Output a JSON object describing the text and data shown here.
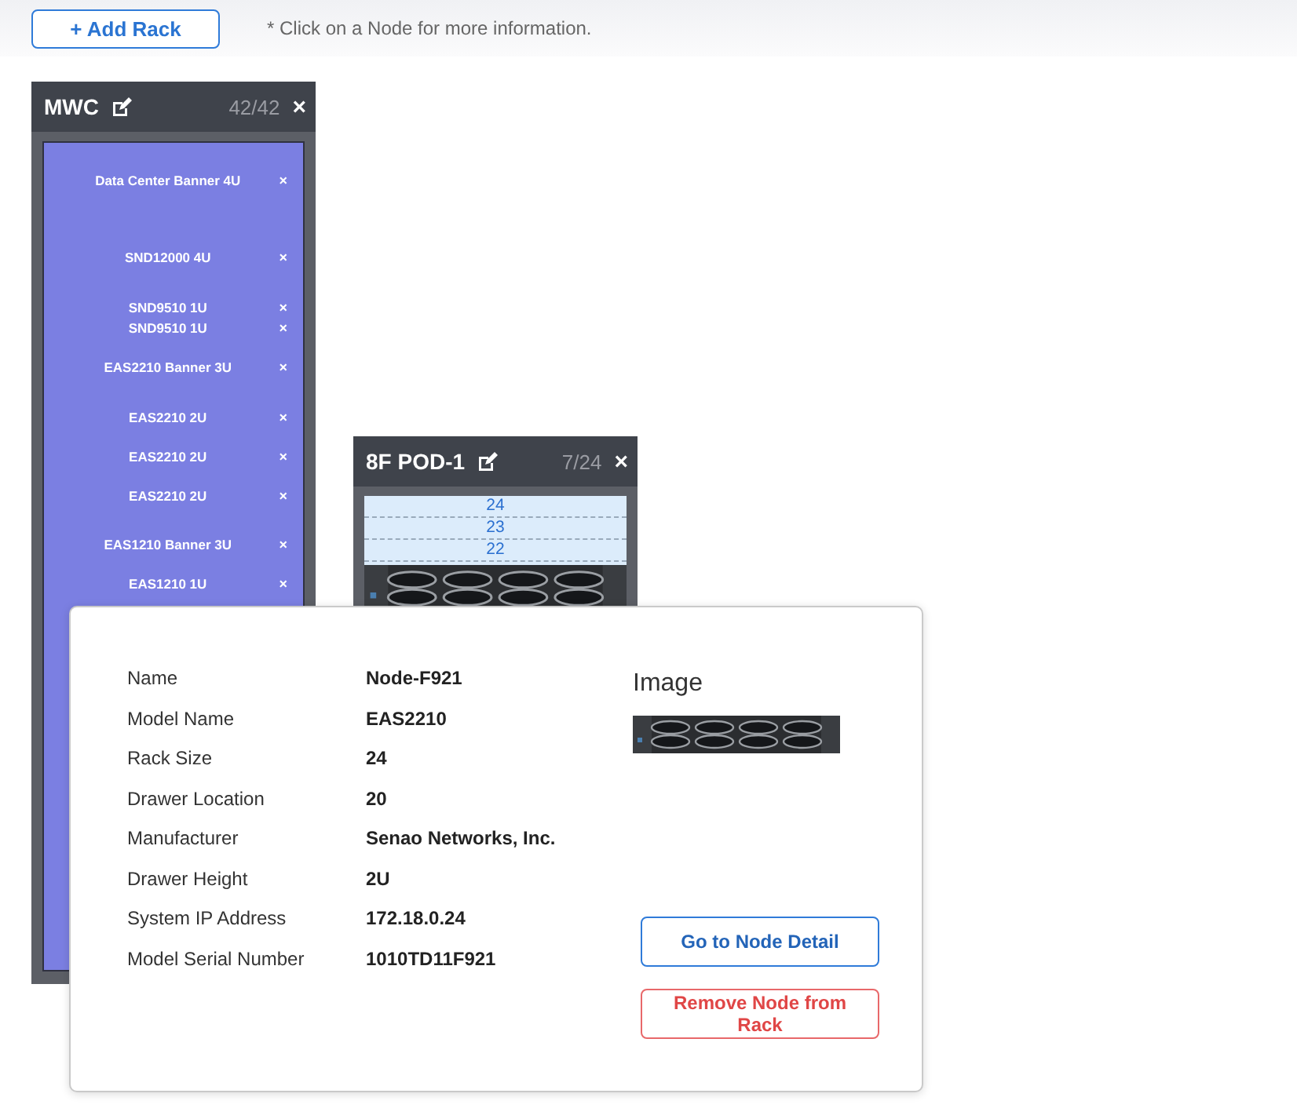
{
  "toolbar": {
    "add_button": {
      "icon": "+",
      "label": "Add Rack"
    },
    "hint": "* Click on a Node for more information."
  },
  "racks": [
    {
      "kind": "full",
      "name": "MWC",
      "count": "42/42",
      "close": "×",
      "items": [
        {
          "label": "Data Center Banner 4U",
          "remove": "×"
        },
        {
          "label": "SND12000 4U",
          "remove": "×"
        },
        {
          "label": "SND9510 1U",
          "remove": "×"
        },
        {
          "label": "SND9510 1U",
          "remove": "×"
        },
        {
          "label": "EAS2210 Banner 3U",
          "remove": "×"
        },
        {
          "label": "EAS2210 2U",
          "remove": "×"
        },
        {
          "label": "EAS2210 2U",
          "remove": "×"
        },
        {
          "label": "EAS2210 2U",
          "remove": "×"
        },
        {
          "label": "EAS1210 Banner 3U",
          "remove": "×"
        },
        {
          "label": "EAS1210 1U",
          "remove": "×"
        }
      ]
    },
    {
      "kind": "slots",
      "name": "8F POD-1",
      "count": "7/24",
      "close": "×",
      "slots": [
        "24",
        "23",
        "22"
      ]
    }
  ],
  "node_popup": {
    "details": [
      {
        "label": "Name",
        "value": "Node-F921"
      },
      {
        "label": "Model Name",
        "value": "EAS2210"
      },
      {
        "label": "Rack Size",
        "value": "24"
      },
      {
        "label": "Drawer Location",
        "value": "20"
      },
      {
        "label": "Manufacturer",
        "value": "Senao Networks, Inc."
      },
      {
        "label": "Drawer Height",
        "value": "2U"
      },
      {
        "label": "System IP Address",
        "value": "172.18.0.24"
      },
      {
        "label": "Model Serial Number",
        "value": "1010TD11F921"
      }
    ],
    "image_label": "Image",
    "buttons": [
      {
        "label": "Go to Node Detail",
        "kind": "primary"
      },
      {
        "label": "Remove Node from Rack",
        "kind": "danger"
      }
    ]
  }
}
